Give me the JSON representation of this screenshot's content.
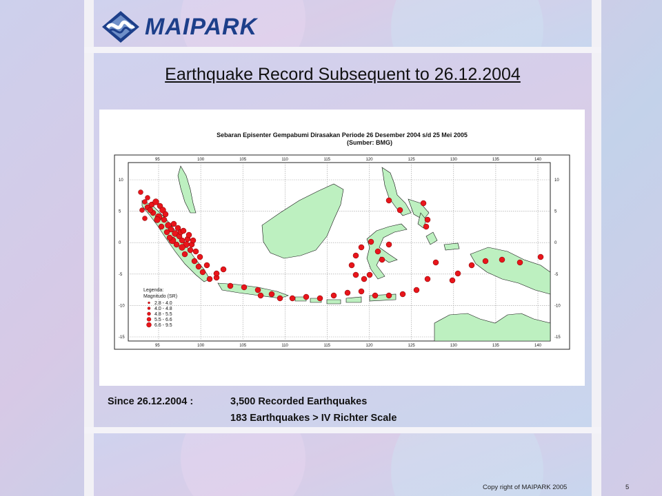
{
  "brand": {
    "name": "MAIPARK"
  },
  "slide": {
    "title": "Earthquake Record Subsequent to 26.12.2004"
  },
  "map": {
    "title": "Sebaran Episenter Gempabumi Dirasakan Periode 26 Desember 2004 s/d 25 Mei 2005",
    "source": "(Sumber: BMG)",
    "lon_ticks": [
      "95",
      "100",
      "105",
      "110",
      "115",
      "120",
      "125",
      "130",
      "135",
      "140"
    ],
    "lat_ticks_left": [
      "10",
      "5",
      "0",
      "-5",
      "-10",
      "-15"
    ],
    "lat_ticks_right": [
      "10",
      "5",
      "0",
      "-5",
      "-10",
      "-15"
    ],
    "legend": {
      "title": "Legenda:",
      "subtitle": "Magnitudo (SR)",
      "items": [
        "2.8 - 4.0",
        "4.0 - 4.8",
        "4.8 - 5.5",
        "5.5 - 6.6",
        "6.6 - 9.5"
      ]
    },
    "colors": {
      "land": "#bdf0c0",
      "quake": "#e8151b",
      "grid": "#888888"
    }
  },
  "caption": {
    "since": "Since 26.12.2004 :",
    "line1": "3,500 Recorded Earthquakes",
    "line2": "183 Earthquakes > IV Richter Scale"
  },
  "footer": {
    "copyright": "Copy right of MAIPARK 2005",
    "page": "5"
  }
}
